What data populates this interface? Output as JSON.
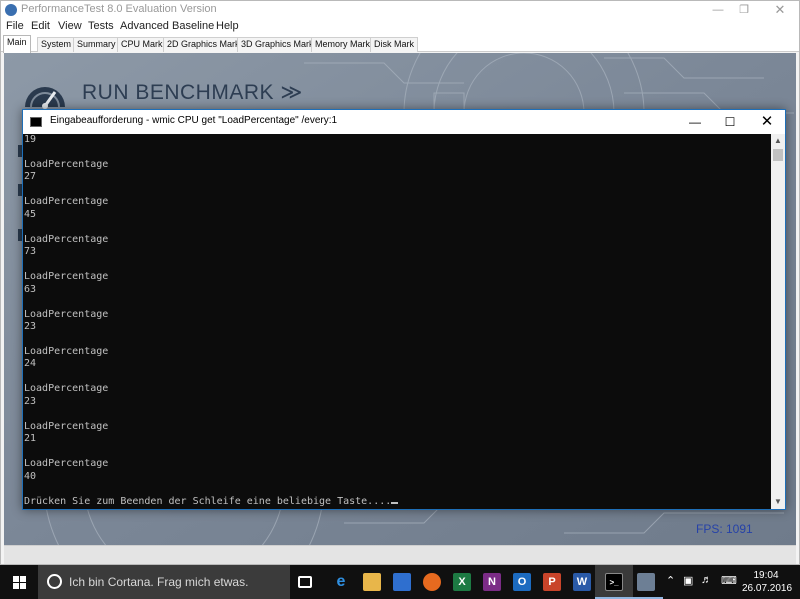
{
  "app": {
    "title": "PerformanceTest 8.0 Evaluation Version",
    "menu": [
      "File",
      "Edit",
      "View",
      "Tests",
      "Advanced",
      "Baseline",
      "Help"
    ],
    "tabs": [
      "Main",
      "System",
      "Summary",
      "CPU Mark",
      "2D Graphics Mark",
      "3D Graphics Mark",
      "Memory Mark",
      "Disk Mark"
    ],
    "active_tab": "Main",
    "banner": "RUN BENCHMARK ≫",
    "fps": "FPS: 1091"
  },
  "cmd": {
    "title": "Eingabeaufforderung - wmic  CPU get \"LoadPercentage\" /every:1",
    "lines": [
      "19",
      "",
      "LoadPercentage",
      "27",
      "",
      "LoadPercentage",
      "45",
      "",
      "LoadPercentage",
      "73",
      "",
      "LoadPercentage",
      "63",
      "",
      "LoadPercentage",
      "23",
      "",
      "LoadPercentage",
      "24",
      "",
      "LoadPercentage",
      "23",
      "",
      "LoadPercentage",
      "21",
      "",
      "LoadPercentage",
      "40",
      "",
      "Drücken Sie zum Beenden der Schleife eine beliebige Taste...."
    ]
  },
  "taskbar": {
    "cortana_text": "Ich bin Cortana. Frag mich etwas.",
    "time": "19:04",
    "date": "26.07.2016",
    "apps": [
      "task-view",
      "edge",
      "file-explorer",
      "store",
      "firefox",
      "excel",
      "onenote",
      "outlook",
      "powerpoint",
      "word",
      "command-prompt",
      "performancetest"
    ]
  },
  "colors": {
    "console_bg": "#0c0c0c",
    "console_text": "#c0c0c0",
    "taskbar_bg": "#101010",
    "fps_text": "#2642a8",
    "window_accent": "#1e6fb8"
  }
}
